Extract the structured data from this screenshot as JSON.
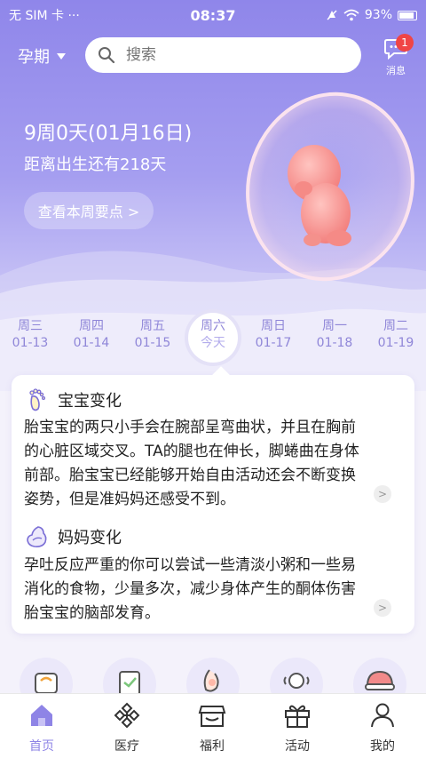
{
  "status_bar": {
    "carrier": "无 SIM 卡 ···",
    "time": "08:37",
    "battery": "93%"
  },
  "top_bar": {
    "stage": "孕期",
    "search_placeholder": "搜索",
    "message_label": "消息",
    "message_badge": "1"
  },
  "hero": {
    "date_title": "9周0天(01月16日)",
    "countdown": "距离出生还有218天",
    "week_button": "查看本周要点 >"
  },
  "days": [
    {
      "weekday": "周三",
      "date": "01-13"
    },
    {
      "weekday": "周四",
      "date": "01-14"
    },
    {
      "weekday": "周五",
      "date": "01-15"
    },
    {
      "weekday": "周六",
      "date": "今天",
      "today": true
    },
    {
      "weekday": "周日",
      "date": "01-17"
    },
    {
      "weekday": "周一",
      "date": "01-18"
    },
    {
      "weekday": "周二",
      "date": "01-19"
    }
  ],
  "card": {
    "baby": {
      "title": "宝宝变化",
      "lines": [
        "胎宝宝的两只小手会在腕部呈弯曲状，并且在胸前",
        "的心脏区域交叉。TA的腿也在伸长，脚蜷曲在身体",
        "前部。胎宝宝已经能够开始自由活动还会不断变换",
        "姿势，但是准妈妈还感受不到。"
      ]
    },
    "mom": {
      "title": "妈妈变化",
      "lines": [
        "孕吐反应严重的你可以尝试一些清淡小粥和一些易",
        "消化的食物，少量多次，减少身体产生的酮体伤害",
        "胎宝宝的脑部发育。"
      ]
    },
    "more_symbol": ">"
  },
  "shortcut_icons": [
    "scale-icon",
    "checklist-icon",
    "belly-icon",
    "baby-rattle-icon",
    "hat-icon"
  ],
  "tabs": [
    {
      "label": "首页",
      "icon": "home-icon",
      "active": true
    },
    {
      "label": "医疗",
      "icon": "medical-icon"
    },
    {
      "label": "福利",
      "icon": "store-icon"
    },
    {
      "label": "活动",
      "icon": "gift-icon"
    },
    {
      "label": "我的",
      "icon": "profile-icon"
    }
  ],
  "colors": {
    "accent": "#8e84e6",
    "badge": "#f04545"
  }
}
